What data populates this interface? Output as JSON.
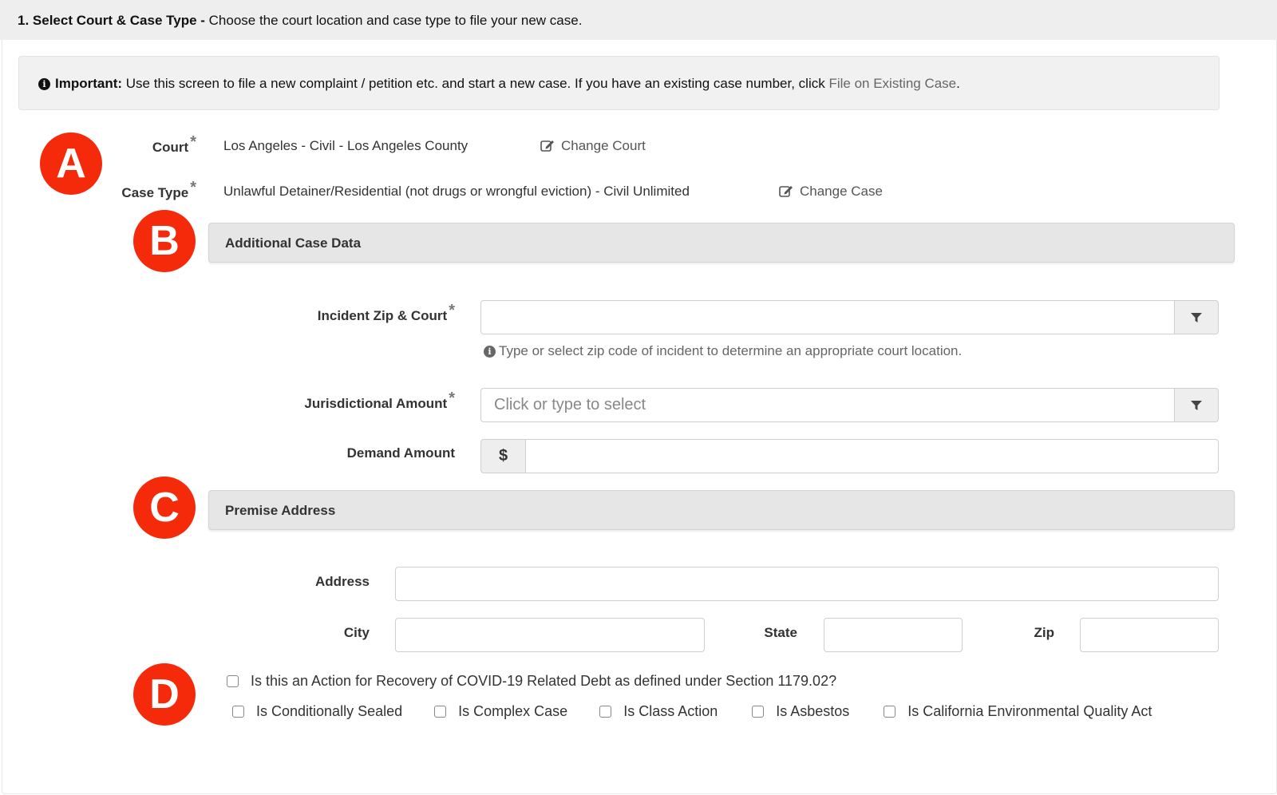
{
  "header": {
    "step_title": "1. Select Court & Case Type -",
    "step_desc": " Choose the court location and case type to file your new case."
  },
  "alert": {
    "icon": "info-circle-icon",
    "label": "Important:",
    "text": " Use this screen to file a new complaint / petition etc. and start a new case. If you have an existing case number, click ",
    "link": "File on Existing Case",
    "suffix": "."
  },
  "badges": [
    "A",
    "B",
    "C",
    "D"
  ],
  "court": {
    "label": "Court",
    "required": "*",
    "value": "Los Angeles - Civil - Los Angeles County",
    "change_label": "Change Court"
  },
  "case_type": {
    "label": "Case Type",
    "required": "*",
    "value": "Unlawful Detainer/Residential (not drugs or wrongful eviction) - Civil Unlimited",
    "change_label": "Change Case"
  },
  "additional_case_data": {
    "title": "Additional Case Data",
    "incident_zip": {
      "label": "Incident Zip & Court",
      "required": "*",
      "value": "",
      "placeholder": "",
      "help": "Type or select zip code of incident to determine an appropriate court location."
    },
    "jurisdictional_amount": {
      "label": "Jurisdictional Amount",
      "required": "*",
      "value": "",
      "placeholder": "Click or type to select"
    },
    "demand_amount": {
      "label": "Demand Amount",
      "currency": "$",
      "value": ""
    }
  },
  "premise_address": {
    "title": "Premise Address",
    "address": {
      "label": "Address",
      "value": ""
    },
    "city": {
      "label": "City",
      "value": ""
    },
    "state": {
      "label": "State",
      "value": ""
    },
    "zip": {
      "label": "Zip",
      "value": ""
    }
  },
  "checkboxes": {
    "covid": {
      "label": "Is this an Action for Recovery of COVID-19 Related Debt as defined under Section 1179.02?",
      "checked": false
    },
    "options": [
      {
        "label": "Is Conditionally Sealed",
        "checked": false
      },
      {
        "label": "Is Complex Case",
        "checked": false
      },
      {
        "label": "Is Class Action",
        "checked": false
      },
      {
        "label": "Is Asbestos",
        "checked": false
      },
      {
        "label": "Is California Environmental Quality Act",
        "checked": false
      }
    ]
  },
  "colors": {
    "badge": "#f52a0a",
    "header_bg": "#eeeeee",
    "section_bg": "#e6e6e6",
    "link": "#666666"
  }
}
